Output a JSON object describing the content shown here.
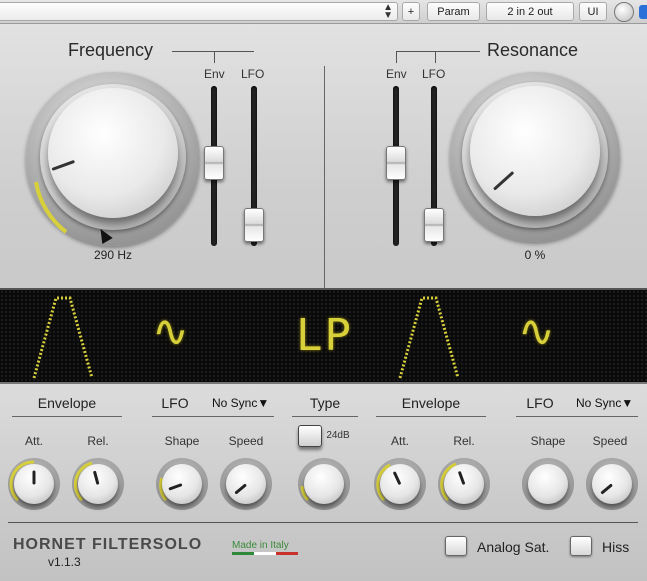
{
  "host": {
    "plus_label": "+",
    "param_label": "Param",
    "io_label": "2 in 2 out",
    "ui_label": "UI"
  },
  "frequency": {
    "title": "Frequency",
    "env_label": "Env",
    "lfo_label": "LFO",
    "value": "290 Hz"
  },
  "resonance": {
    "title": "Resonance",
    "env_label": "Env",
    "lfo_label": "LFO",
    "value": "0 %"
  },
  "display": {
    "mode_text": "LP",
    "wave_glyph": "∿",
    "color": "#d8d03a"
  },
  "lower": {
    "env1": {
      "title": "Envelope",
      "att": "Att.",
      "rel": "Rel."
    },
    "lfo1": {
      "title": "LFO",
      "sync": "No Sync▼",
      "shape": "Shape",
      "speed": "Speed"
    },
    "type": {
      "title": "Type",
      "db_label": "24dB"
    },
    "env2": {
      "title": "Envelope",
      "att": "Att.",
      "rel": "Rel."
    },
    "lfo2": {
      "title": "LFO",
      "sync": "No Sync▼",
      "shape": "Shape",
      "speed": "Speed"
    }
  },
  "footer": {
    "brand": "HORNET FILTERSOLO",
    "version": "v1.1.3",
    "made_in": "Made in Italy",
    "analog_sat": "Analog Sat.",
    "hiss": "Hiss"
  }
}
